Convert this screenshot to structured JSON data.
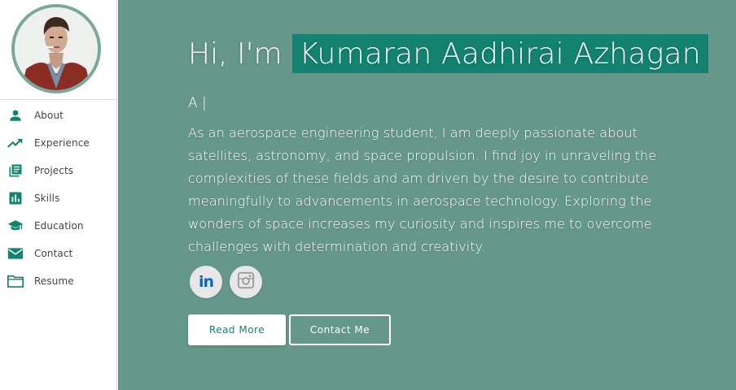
{
  "colors": {
    "accent": "#13836f",
    "main_background": "#65978a",
    "icon_color": "#13836f",
    "avatar_border": "#7aa89c"
  },
  "sidebar": {
    "avatar_icon": "profile-photo",
    "items": [
      {
        "label": "About",
        "icon": "person-icon"
      },
      {
        "label": "Experience",
        "icon": "trending-up-icon"
      },
      {
        "label": "Projects",
        "icon": "library-books-icon"
      },
      {
        "label": "Skills",
        "icon": "bar-chart-icon"
      },
      {
        "label": "Education",
        "icon": "graduation-cap-icon"
      },
      {
        "label": "Contact",
        "icon": "mail-icon"
      },
      {
        "label": "Resume",
        "icon": "folder-icon"
      }
    ]
  },
  "hero": {
    "greeting_prefix": "Hi, I'm",
    "name": "Kumaran Aadhirai Azhagan",
    "typed_text": "A |",
    "bio": "As an aerospace engineering student, I am deeply passionate about satellites, astronomy, and space propulsion. I find joy in unraveling the complexities of these fields and am driven by the desire to contribute meaningfully to advancements in aerospace technology. Exploring the wonders of space increases my curiosity and inspires me to overcome challenges with determination and creativity.",
    "socials": [
      {
        "icon": "linkedin-icon",
        "text": "in"
      },
      {
        "icon": "instagram-icon"
      }
    ],
    "buttons": {
      "read_more": "Read More",
      "contact_me": "Contact Me"
    }
  }
}
